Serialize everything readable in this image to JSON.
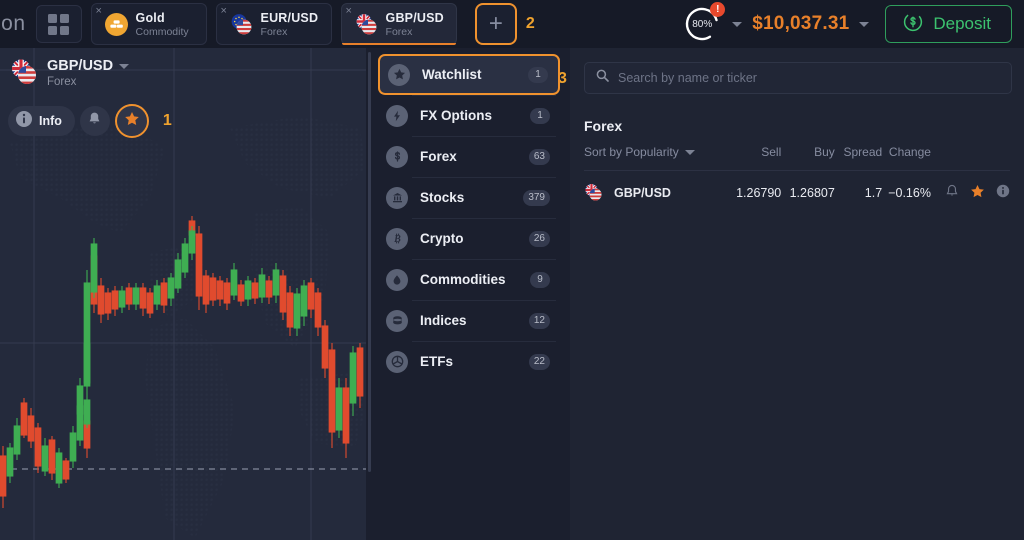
{
  "brand": {
    "logo_text": "ion"
  },
  "topbar": {
    "grid_icon": "apps-grid-icon",
    "tabs": [
      {
        "name": "Gold",
        "sub": "Commodity",
        "icon": "gold-bars-icon",
        "close": "×",
        "active": false
      },
      {
        "name": "EUR/USD",
        "sub": "Forex",
        "icon": "eur-usd-flag-icon",
        "close": "×",
        "active": false
      },
      {
        "name": "GBP/USD",
        "sub": "Forex",
        "icon": "gbp-usd-flag-icon",
        "close": "×",
        "active": true
      }
    ],
    "add_tab_label": "+",
    "annotation_2": "2",
    "progress": {
      "value": "80%",
      "badge": "!"
    },
    "balance": "$10,037.31",
    "deposit_label": "Deposit",
    "deposit_icon": "dollar-refresh-icon",
    "accent_orange": "#e8802a",
    "accent_green": "#3cc36f"
  },
  "chart": {
    "symbol": "GBP/USD",
    "category": "Forex",
    "info_label": "Info",
    "info_icon": "info-icon",
    "bell_icon": "bell-icon",
    "star_icon": "star-icon",
    "annotation_1": "1",
    "bull_color": "#3fae52",
    "bear_color": "#e04b2e",
    "background": "#242a3c"
  },
  "menu": {
    "annotation_3": "3",
    "items": [
      {
        "label": "Watchlist",
        "count": "1",
        "icon": "star-circle-icon",
        "selected": true
      },
      {
        "label": "FX Options",
        "count": "1",
        "icon": "lightning-icon",
        "selected": false
      },
      {
        "label": "Forex",
        "count": "63",
        "icon": "dollar-circle-icon",
        "selected": false
      },
      {
        "label": "Stocks",
        "count": "379",
        "icon": "bank-icon",
        "selected": false
      },
      {
        "label": "Crypto",
        "count": "26",
        "icon": "bitcoin-icon",
        "selected": false
      },
      {
        "label": "Commodities",
        "count": "9",
        "icon": "oil-drop-icon",
        "selected": false
      },
      {
        "label": "Indices",
        "count": "12",
        "icon": "cylinder-icon",
        "selected": false
      },
      {
        "label": "ETFs",
        "count": "22",
        "icon": "pie-circle-icon",
        "selected": false
      }
    ]
  },
  "right": {
    "search": {
      "placeholder": "Search by name or ticker",
      "icon": "search-icon"
    },
    "section_title": "Forex",
    "sort_label": "Sort by Popularity",
    "columns": {
      "sell": "Sell",
      "buy": "Buy",
      "spread": "Spread",
      "change": "Change"
    },
    "rows": [
      {
        "symbol": "GBP/USD",
        "flag": "gbp-usd-flag-icon",
        "sell": "1.26790",
        "buy": "1.26807",
        "spread": "1.7",
        "change": "−0.16%",
        "change_negative": true,
        "bell_icon": "bell-icon",
        "star_icon": "star-filled-icon",
        "info_icon": "info-icon"
      }
    ]
  }
}
